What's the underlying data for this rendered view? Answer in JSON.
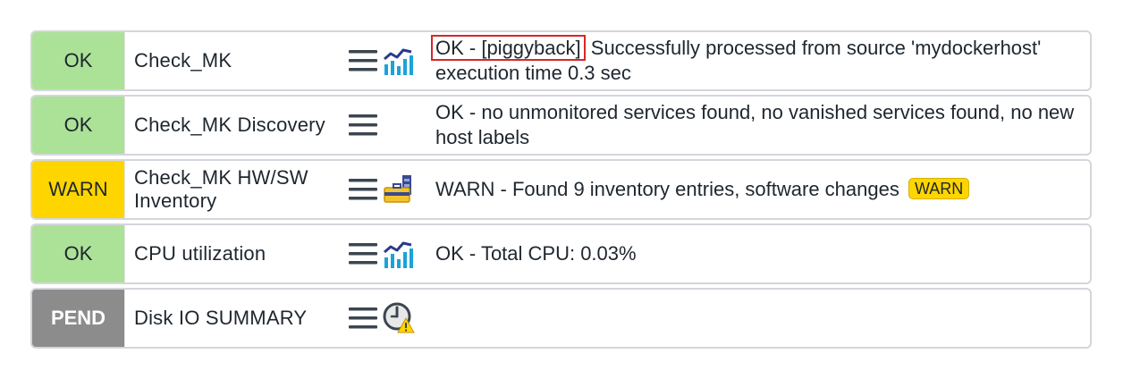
{
  "services": [
    {
      "state": "OK",
      "name": "Check_MK",
      "summary_highlight": "OK - [piggyback]",
      "summary": "Successfully processed from source 'mydockerhost' execution time 0.3 sec",
      "icons": [
        "menu-icon",
        "performance-graph-icon"
      ]
    },
    {
      "state": "OK",
      "name": "Check_MK Discovery",
      "summary": "OK - no unmonitored services found, no vanished services found, no new host labels",
      "icons": [
        "menu-icon"
      ]
    },
    {
      "state": "WARN",
      "name": "Check_MK HW/SW Inventory",
      "summary": "WARN - Found 9 inventory entries, software changes",
      "badge": "WARN",
      "icons": [
        "menu-icon",
        "inventory-icon"
      ]
    },
    {
      "state": "OK",
      "name": "CPU utilization",
      "summary": "OK - Total CPU: 0.03%",
      "icons": [
        "menu-icon",
        "performance-graph-icon"
      ]
    },
    {
      "state": "PEND",
      "name": "Disk IO SUMMARY",
      "summary": "",
      "icons": [
        "menu-icon",
        "pending-clock-warning-icon"
      ]
    }
  ],
  "colors": {
    "ok": "#abe297",
    "warn": "#ffd500",
    "pend": "#8c8c8c",
    "highlight_border": "#d62728",
    "text": "#1e262e"
  }
}
